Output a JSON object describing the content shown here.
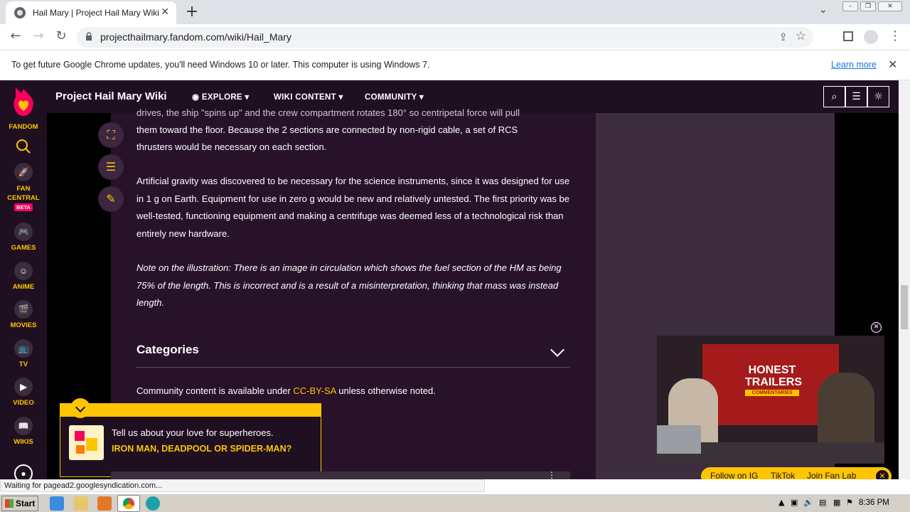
{
  "browser": {
    "tab_title": "Hail Mary | Project Hail Mary Wiki | Fandom",
    "url": "projecthailmary.fandom.com/wiki/Hail_Mary",
    "infobar_message": "To get future Google Chrome updates, you'll need Windows 10 or later. This computer is using Windows 7.",
    "learn_more": "Learn more",
    "status_text": "Waiting for pagead2.googlesyndication.com..."
  },
  "fandom_rail": {
    "brand": "FANDOM",
    "items": [
      {
        "label": "FAN CENTRAL",
        "badge": "BETA",
        "icon": "rocket-icon"
      },
      {
        "label": "GAMES",
        "icon": "gamepad-icon"
      },
      {
        "label": "ANIME",
        "icon": "anime-face-icon"
      },
      {
        "label": "MOVIES",
        "icon": "clapper-icon"
      },
      {
        "label": "TV",
        "icon": "tv-icon"
      },
      {
        "label": "VIDEO",
        "icon": "play-icon"
      },
      {
        "label": "WIKIS",
        "icon": "book-icon"
      }
    ]
  },
  "topnav": {
    "wiki_name": "Project Hail Mary Wiki",
    "links": [
      "EXPLORE",
      "WIKI CONTENT",
      "COMMUNITY"
    ]
  },
  "article": {
    "p0_line1": "drives, the ship \"spins up\" and the crew compartment rotates 180° so centripetal force will pull",
    "p0_line2": "them toward the floor. Because the 2 sections are connected by non-rigid cable, a set of RCS",
    "p0_line3": "thrusters would be necessary on each section.",
    "p1": "Artificial gravity was discovered to be necessary for the science instruments, since it was designed for use in 1 g on Earth. Equipment for use in zero g would be new and relatively untested. The first priority was be well-tested, functioning equipment and making a centrifuge was deemed less of a technological risk than entirely new hardware.",
    "p2": "Note on the illustration: There is an image in circulation which shows the fuel section of the HM as being 75% of the length. This is incorrect and is a result of a misinterpretation, thinking that mass was instead length.",
    "categories": "Categories",
    "license_pre": "Community content is available under ",
    "license_link": "CC-BY-SA",
    "license_post": " unless otherwise noted."
  },
  "promo": {
    "question": "Tell us about your love for superheroes.",
    "answer": "IRON MAN, DEADPOOL OR SPIDER-MAN?"
  },
  "video": {
    "logo_line1": "HONEST",
    "logo_line2": "TRAILERS",
    "logo_line3": "COMMENTARIES",
    "links": [
      "Follow on IG",
      "TikTok",
      "Join Fan Lab"
    ]
  },
  "taskbar": {
    "start": "Start",
    "clock": "8:36 PM"
  }
}
